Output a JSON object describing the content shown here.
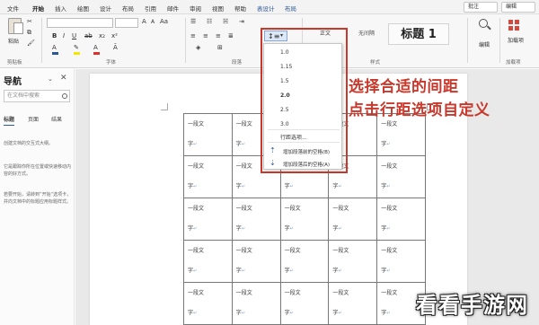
{
  "menubar": {
    "items": [
      "文件",
      "开始",
      "插入",
      "绘图",
      "设计",
      "布局",
      "引用",
      "邮件",
      "审阅",
      "视图",
      "帮助",
      "表设计",
      "布局"
    ],
    "active_index": 1,
    "comment_label": "批注",
    "edit_label": "编辑"
  },
  "ribbon": {
    "paste_label": "粘贴",
    "group_labels": [
      "剪贴板",
      "字体",
      "段落",
      "样式",
      "加载项"
    ],
    "styles": [
      "正文",
      "无间隔",
      "标题 1"
    ],
    "find_label": "编辑",
    "addin_label": "加载项"
  },
  "nav": {
    "title": "导航",
    "search_placeholder": "在文档中搜索",
    "tabs": [
      "标题",
      "页面",
      "结果"
    ],
    "texts": [
      "创建文档的交互式大纲。",
      "它是跟踪你所在位置或快速移动内容的好方式。",
      "若要开始，请转到“开始”选项卡，并向文档中的标题应用标题样式。"
    ]
  },
  "spacing_menu": {
    "options": [
      "1.0",
      "1.15",
      "1.5",
      "2.0",
      "2.5",
      "3.0"
    ],
    "selected_index": 3,
    "more_label": "行距选项...",
    "add_before": "增加段落前的空格(B)",
    "add_after": "增加段落后的空格(A)"
  },
  "table": {
    "cell_line1": "一段文",
    "cell_line2": "字",
    "return_mark": "↵",
    "rows": 5,
    "cols": 5
  },
  "annotation": {
    "line1": "选择合适的间距",
    "line2": "点击行距选项自定义",
    "color": "#c8392c"
  },
  "watermark": "看看手游网",
  "colors": {
    "accent": "#2b5797",
    "highlight_red": "#c8392c"
  }
}
